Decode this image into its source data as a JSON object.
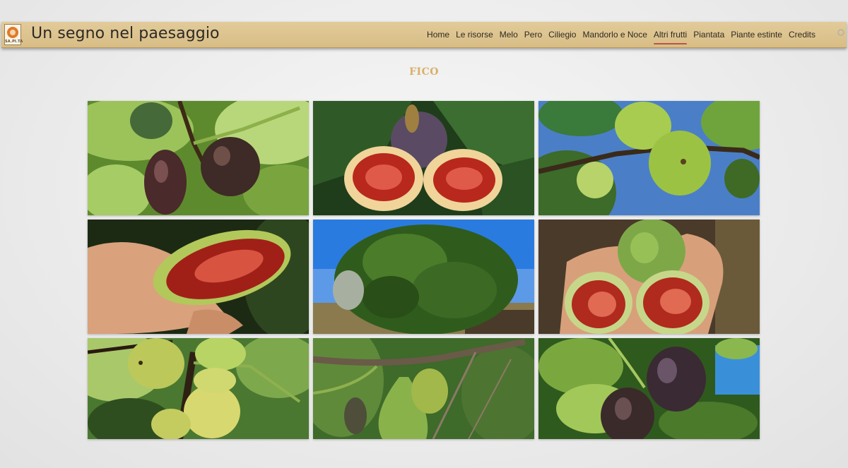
{
  "header": {
    "logo_text": "SA.PI.TA",
    "site_title": "Un segno nel paesaggio",
    "nav": [
      {
        "label": "Home"
      },
      {
        "label": "Le risorse"
      },
      {
        "label": "Melo"
      },
      {
        "label": "Pero"
      },
      {
        "label": "Ciliegio"
      },
      {
        "label": "Mandorlo e Noce"
      },
      {
        "label": "Altri frutti",
        "active": true
      },
      {
        "label": "Piantata"
      },
      {
        "label": "Piante estinte"
      },
      {
        "label": "Credits"
      }
    ]
  },
  "page": {
    "title": "FICO"
  },
  "colors": {
    "navbar": "#dcc28c",
    "title_accent": "#d9b068",
    "active_underline": "#c0504d"
  },
  "gallery": [
    {
      "subject": "dark purple figs on branch"
    },
    {
      "subject": "split fig showing red pulp"
    },
    {
      "subject": "green figs on branch against sky"
    },
    {
      "subject": "fig held open in hand"
    },
    {
      "subject": "fig tree under blue sky"
    },
    {
      "subject": "halved green fig in palm"
    },
    {
      "subject": "ripening green figs cluster"
    },
    {
      "subject": "pear-shaped green figs on twig"
    },
    {
      "subject": "purple figs among leaves"
    }
  ]
}
